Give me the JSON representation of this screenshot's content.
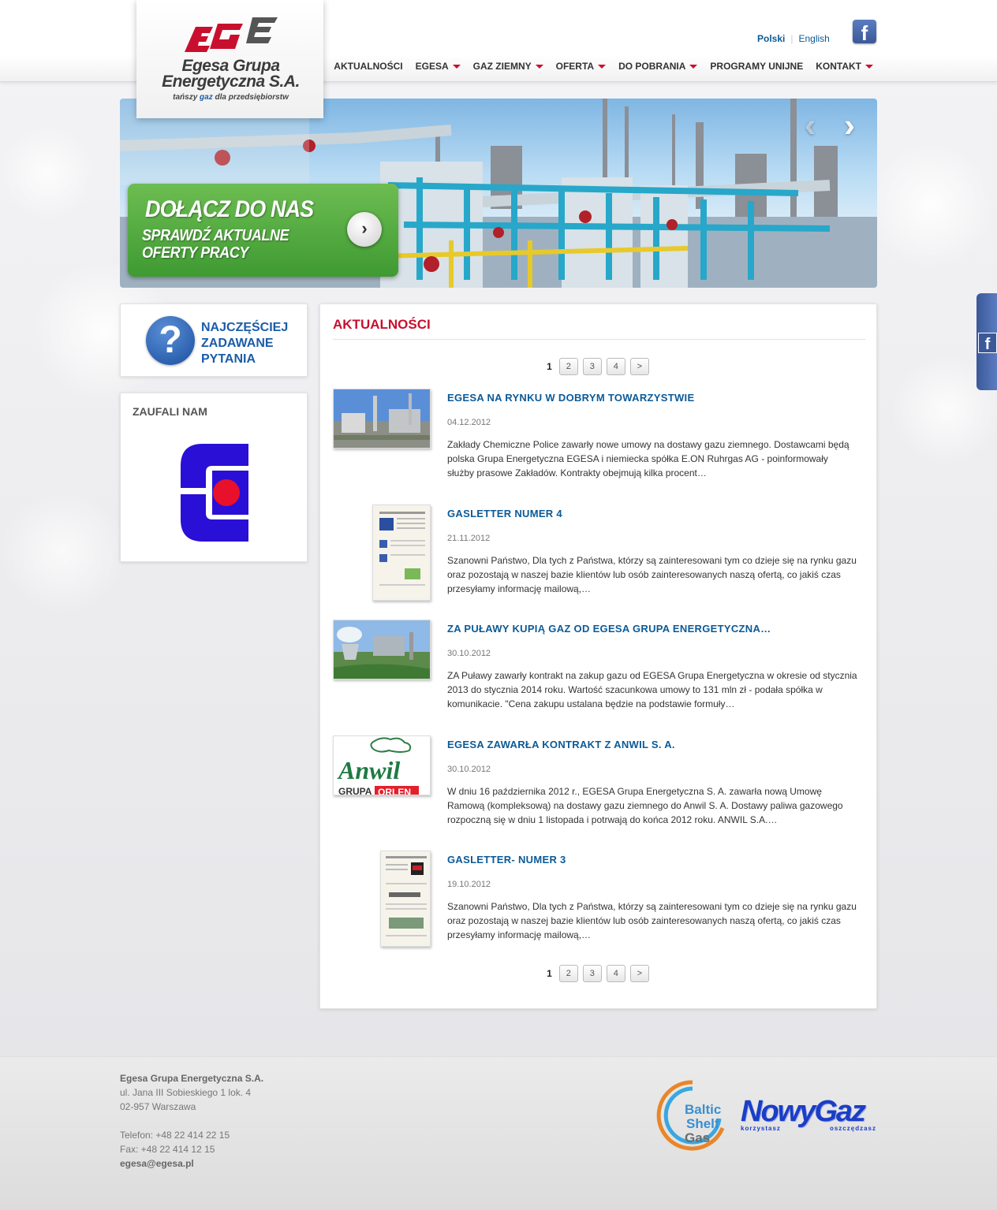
{
  "header": {
    "logo_mark": "EGE",
    "logo_name_line1": "Egesa Grupa",
    "logo_name_line2": "Energetyczna S.A.",
    "logo_tagline_pre": "tańszy",
    "logo_tagline_gaz": "gaz",
    "logo_tagline_post": "dla przedsiębiorstw",
    "languages": [
      "Polski",
      "English"
    ],
    "facebook_glyph": "f"
  },
  "nav": {
    "items": [
      {
        "label": "AKTUALNOŚCI",
        "dropdown": false
      },
      {
        "label": "EGESA",
        "dropdown": true
      },
      {
        "label": "GAZ ZIEMNY",
        "dropdown": true
      },
      {
        "label": "OFERTA",
        "dropdown": true
      },
      {
        "label": "DO POBRANIA",
        "dropdown": true
      },
      {
        "label": "PROGRAMY UNIJNE",
        "dropdown": false
      },
      {
        "label": "KONTAKT",
        "dropdown": true
      }
    ]
  },
  "banner": {
    "promo_title": "DOŁĄCZ DO NAS",
    "promo_sub_line1": "SPRAWDŹ AKTUALNE",
    "promo_sub_line2": "OFERTY PRACY",
    "promo_button_glyph": "›",
    "prev_glyph": "‹",
    "next_glyph": "›"
  },
  "sidebar": {
    "faq_glyph": "?",
    "faq_line1": "NAJCZĘŚCIEJ",
    "faq_line2": "ZADAWANE",
    "faq_line3": "PYTANIA",
    "trusted_title": "ZAUFALI NAM"
  },
  "content": {
    "title": "AKTUALNOŚCI",
    "pager": {
      "current": "1",
      "pages": [
        "2",
        "3",
        "4",
        ">"
      ]
    },
    "news": [
      {
        "title": "EGESA NA RYNKU W DOBRYM TOWARZYSTWIE",
        "date": "04.12.2012",
        "excerpt": "Zakłady Chemiczne Police zawarły nowe umowy na dostawy gazu ziemnego. Dostawcami będą polska Grupa Energetyczna EGESA i niemiecka spółka E.ON Ruhrgas AG - poinformowały służby prasowe Zakładów. Kontrakty obejmują kilka procent…"
      },
      {
        "title": "GASLETTER NUMER 4",
        "date": "21.11.2012",
        "excerpt": "  Szanowni Państwo, Dla tych z Państwa, którzy są zainteresowani tym co dzieje się na rynku gazu oraz pozostają w naszej bazie klientów lub osób zainteresowanych naszą ofertą, co jakiś czas przesyłamy informację mailową,…"
      },
      {
        "title": "ZA PUŁAWY KUPIĄ GAZ OD EGESA GRUPA ENERGETYCZNA…",
        "date": "30.10.2012",
        "excerpt": "ZA Puławy zawarły kontrakt na zakup gazu od EGESA Grupa Energetyczna w okresie od stycznia 2013 do stycznia 2014 roku. Wartość szacunkowa umowy to 131 mln zł - podała spółka w komunikacie. \"Cena zakupu ustalana będzie na podstawie formuły…"
      },
      {
        "title": "EGESA ZAWARŁA KONTRAKT Z ANWIL S. A.",
        "date": "30.10.2012",
        "excerpt": "W dniu 16 października 2012 r., EGESA Grupa Energetyczna S. A. zawarła nową Umowę Ramową (kompleksową) na dostawy gazu ziemnego do Anwil S. A. Dostawy paliwa gazowego rozpoczną się w dniu 1 listopada i potrwają do końca 2012 roku. ANWIL S.A.…"
      },
      {
        "title": "GASLETTER- NUMER 3",
        "date": "19.10.2012",
        "excerpt": "Szanowni Państwo, Dla tych z Państwa, którzy są zainteresowani tym co dzieje się na rynku gazu oraz pozostają w naszej bazie klientów lub osób zainteresowanych naszą ofertą, co jakiś czas przesyłamy informację mailową,…"
      }
    ],
    "thumb_text": {
      "anwil_name": "Anwil",
      "anwil_grupa": "GRUPA",
      "anwil_orlen": "ORLEN"
    }
  },
  "footer": {
    "company": "Egesa Grupa Energetyczna S.A.",
    "address1": "ul. Jana III Sobieskiego 1 lok. 4",
    "address2": "02-957 Warszawa",
    "phone": "Telefon: +48 22 414 22 15",
    "fax": "Fax: +48 22 414 12 15",
    "email": "egesa@egesa.pl",
    "baltic_line1": "Baltic",
    "baltic_line2": "Shelf",
    "baltic_line3": "Gas",
    "nowygaz_name": "NowyGaz",
    "nowygaz_tag1": "korzystasz",
    "nowygaz_tag2": "oszczędzasz"
  },
  "colors": {
    "brand_red": "#c8102e",
    "brand_blue": "#0b5a97",
    "facebook_blue": "#3b5998",
    "promo_green": "#4fa83c"
  },
  "icons": [
    "facebook-icon",
    "dropdown-arrow-icon",
    "chevron-right-icon",
    "question-icon",
    "chevron-left-icon"
  ]
}
